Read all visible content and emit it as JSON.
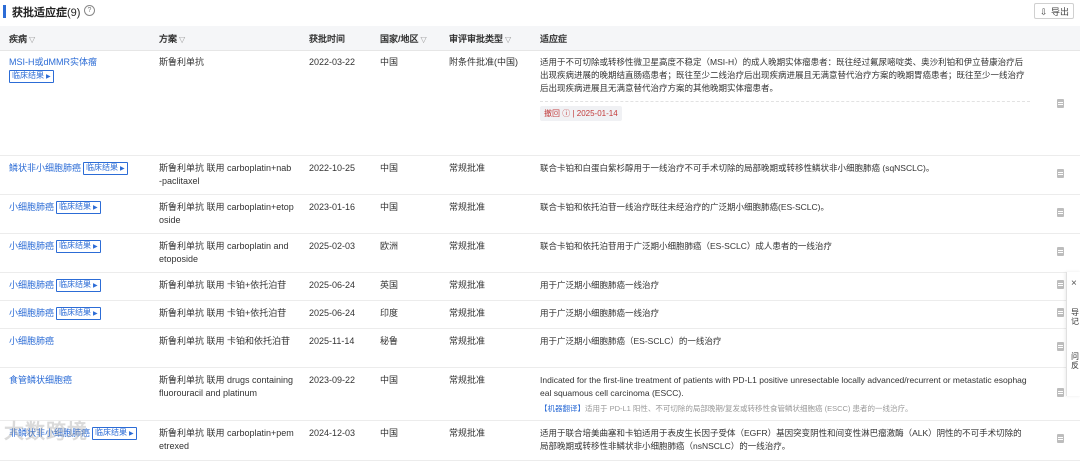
{
  "header": {
    "title": "获批适应症",
    "count": "(9)",
    "export_label": "导出"
  },
  "columns": [
    "疾病",
    "方案",
    "获批时间",
    "国家/地区",
    "审评审批类型",
    "适应症"
  ],
  "clinical_tag": "临床结果",
  "rows": [
    {
      "disease": "MSI-H或dMMR实体瘤",
      "regimen": "斯鲁利单抗",
      "date": "2022-03-22",
      "country": "中国",
      "type": "附条件批准(中国)",
      "indication": "适用于不可切除或转移性微卫星高度不稳定（MSI-H）的成人晚期实体瘤患者：既往经过氟尿嘧啶类、奥沙利铂和伊立替康治疗后出现疾病进展的晚期结直肠癌患者；既往至少二线治疗后出现疾病进展且无满意替代治疗方案的晚期胃癌患者；既往至少一线治疗后出现疾病进展且无满意替代治疗方案的其他晚期实体瘤患者。",
      "withdraw_label": "撤回",
      "withdraw_date": "2025-01-14"
    },
    {
      "disease": "鳞状非小细胞肺癌",
      "regimen": "斯鲁利单抗 联用 carboplatin+nab-paclitaxel",
      "date": "2022-10-25",
      "country": "中国",
      "type": "常规批准",
      "indication": "联合卡铂和白蛋白紫杉醇用于一线治疗不可手术切除的局部晚期或转移性鳞状非小细胞肺癌 (sqNSCLC)。"
    },
    {
      "disease": "小细胞肺癌",
      "regimen": "斯鲁利单抗 联用 carboplatin+etoposide",
      "date": "2023-01-16",
      "country": "中国",
      "type": "常规批准",
      "indication": "联合卡铂和依托泊苷一线治疗既往未经治疗的广泛期小细胞肺癌(ES-SCLC)。"
    },
    {
      "disease": "小细胞肺癌",
      "regimen": "斯鲁利单抗 联用 carboplatin and etoposide",
      "date": "2025-02-03",
      "country": "欧洲",
      "type": "常规批准",
      "indication": "联合卡铂和依托泊苷用于广泛期小细胞肺癌（ES-SCLC）成人患者的一线治疗"
    },
    {
      "disease": "小细胞肺癌",
      "regimen": "斯鲁利单抗 联用 卡铂+依托泊苷",
      "date": "2025-06-24",
      "country": "英国",
      "type": "常规批准",
      "indication": "用于广泛期小细胞肺癌一线治疗"
    },
    {
      "disease": "小细胞肺癌",
      "regimen": "斯鲁利单抗 联用 卡铂+依托泊苷",
      "date": "2025-06-24",
      "country": "印度",
      "type": "常规批准",
      "indication": "用于广泛期小细胞肺癌一线治疗"
    },
    {
      "disease": "小细胞肺癌",
      "regimen": "斯鲁利单抗 联用 卡铂和依托泊苷",
      "date": "2025-11-14",
      "country": "秘鲁",
      "type": "常规批准",
      "indication": "用于广泛期小细胞肺癌（ES-SCLC）的一线治疗"
    },
    {
      "disease": "食管鳞状细胞癌",
      "regimen": "斯鲁利单抗 联用 drugs containing fluorouracil and platinum",
      "date": "2023-09-22",
      "country": "中国",
      "type": "常规批准",
      "indication": "Indicated for the first-line treatment of patients with PD-L1 positive unresectable locally advanced/recurrent or metastatic esophageal squamous cell carcinoma (ESCC).",
      "mt_label": "【机器翻译】",
      "mt_text": "适用于 PD-L1 阳性、不可切除的局部晚期/复发或转移性食管鳞状细胞癌 (ESCC) 患者的一线治疗。"
    },
    {
      "disease": "非鳞状非小细胞肺癌",
      "regimen": "斯鲁利单抗 联用 carboplatin+pemetrexed",
      "date": "2024-12-03",
      "country": "中国",
      "type": "常规批准",
      "indication": "适用于联合培美曲塞和卡铂适用于表皮生长因子受体（EGFR）基因突变阴性和间变性淋巴瘤激酶（ALK）阴性的不可手术切除的局部晚期或转移性非鳞状非小细胞肺癌（nsNSCLC）的一线治疗。"
    }
  ],
  "side_panel": {
    "close": "×",
    "item1": "导记",
    "item2": "问反"
  },
  "watermark": "大数跨境"
}
